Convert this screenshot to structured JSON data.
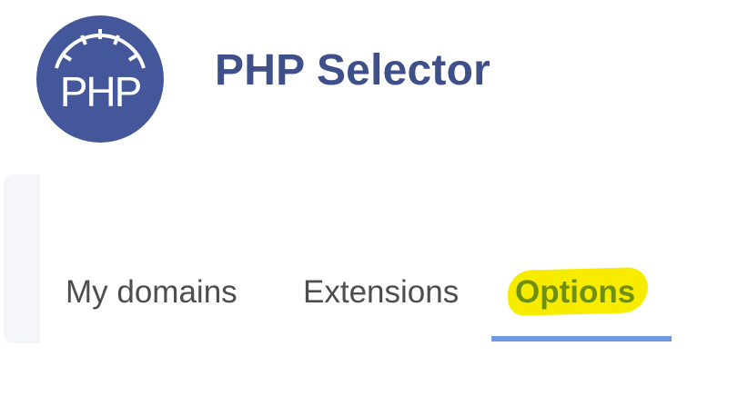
{
  "header": {
    "logo_text": "PHP",
    "title": "PHP Selector"
  },
  "tabs": [
    {
      "label": "My domains",
      "active": false
    },
    {
      "label": "Extensions",
      "active": false
    },
    {
      "label": "Options",
      "active": true,
      "highlighted": true
    }
  ],
  "colors": {
    "brand": "#3f4f8a",
    "logo_bg": "#44579a",
    "active_tab_underline": "#6e97e4",
    "highlight": "#f7ec00",
    "active_tab_text": "#6f8f10",
    "tab_text": "#4d4d4d"
  }
}
